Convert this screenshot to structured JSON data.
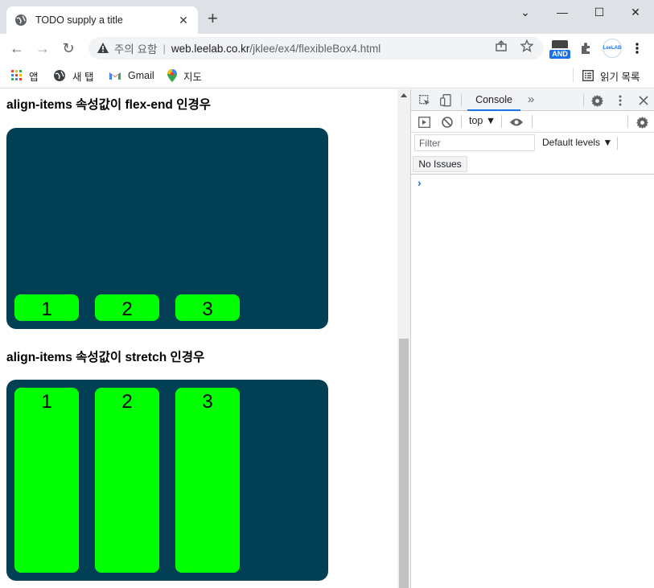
{
  "tab": {
    "title": "TODO supply a title",
    "close": "✕"
  },
  "newtab": "+",
  "window": {
    "minimize": "—",
    "maximize": "☐",
    "close": "✕",
    "dropdown": "⌄"
  },
  "toolbar": {
    "back": "←",
    "forward": "→",
    "reload": "↻"
  },
  "omnibox": {
    "security": "주의 요함",
    "separator": "|",
    "host": "web.leelab.co.kr",
    "path": "/jklee/ex4/flexibleBox4.html"
  },
  "extensions": {
    "and_label": "AND",
    "leelab_label": "LeeLAB"
  },
  "bookmarks": {
    "items": [
      {
        "label": "앱",
        "icon": "apps-grid-icon"
      },
      {
        "label": "새 탭",
        "icon": "globe-icon"
      },
      {
        "label": "Gmail",
        "icon": "gmail-icon"
      },
      {
        "label": "지도",
        "icon": "maps-pin-icon"
      }
    ],
    "reading_list": "읽기 목록"
  },
  "page": {
    "section1": {
      "heading": "align-items 속성값이 flex-end 인경우",
      "items": [
        "1",
        "2",
        "3"
      ]
    },
    "section2": {
      "heading": "align-items 속성값이 stretch 인경우",
      "items": [
        "1",
        "2",
        "3"
      ]
    },
    "colors": {
      "container": "#003f54",
      "item": "#00ff00"
    }
  },
  "devtools": {
    "console_tab": "Console",
    "more_tabs": "»",
    "context": "top ▼",
    "filter_placeholder": "Filter",
    "levels": "Default levels ▼",
    "issues": "No Issues",
    "prompt": "›"
  }
}
